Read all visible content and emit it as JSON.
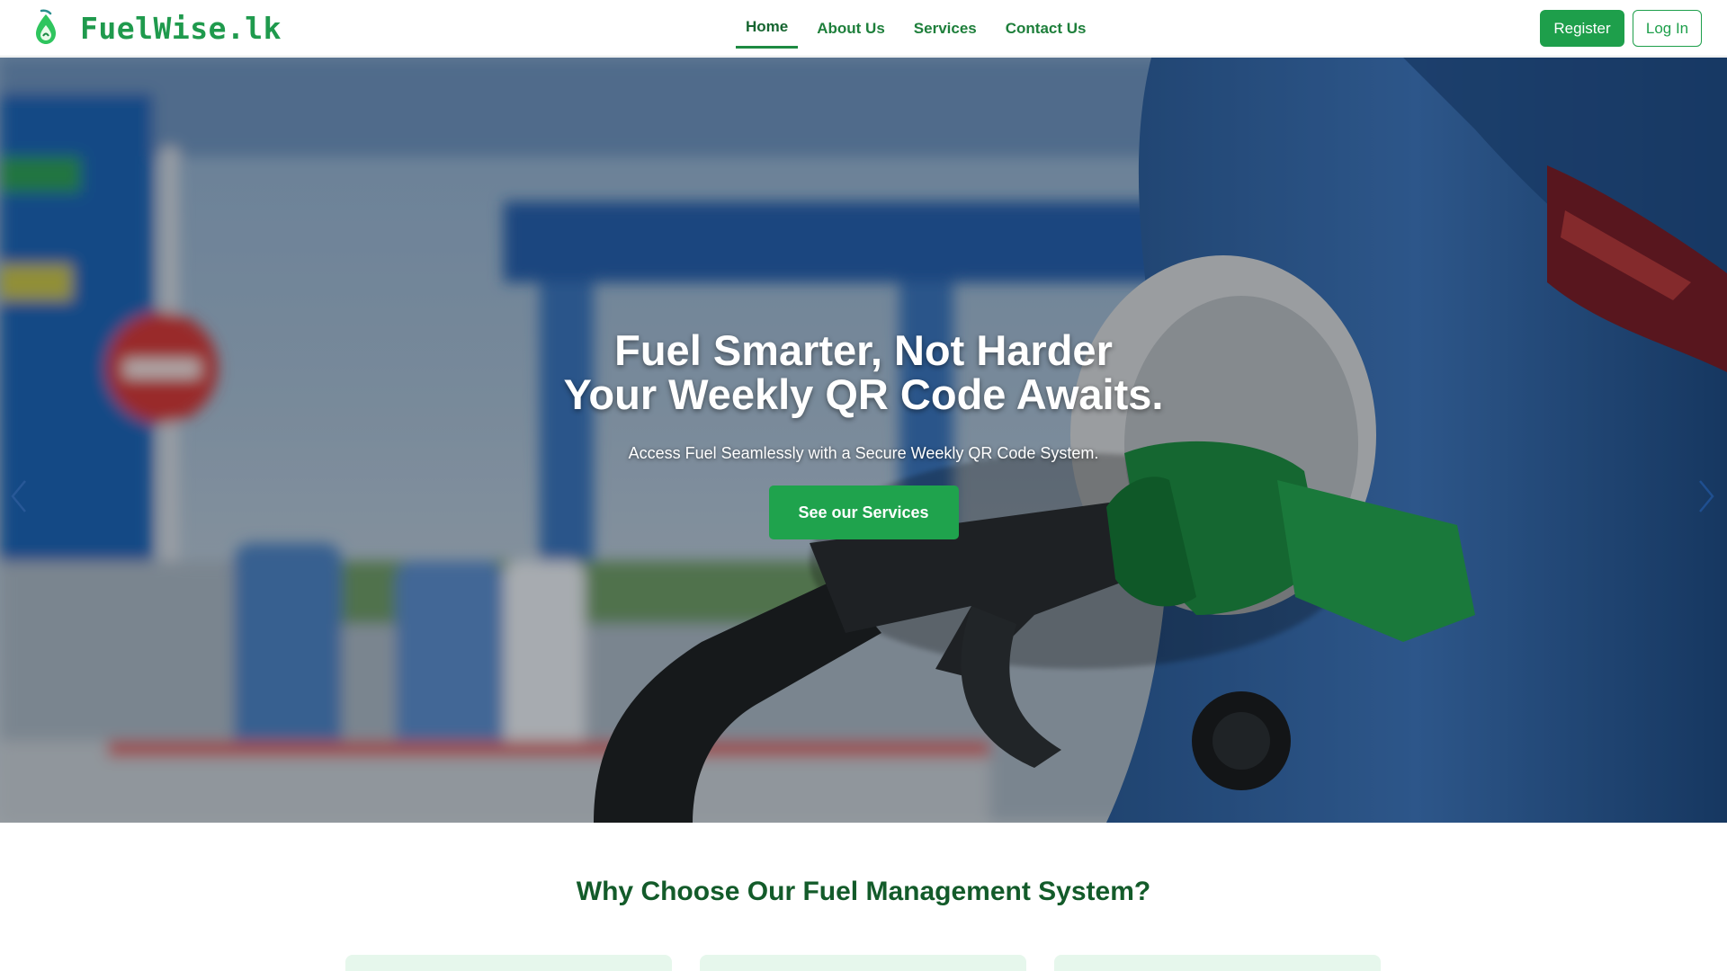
{
  "brand": {
    "name": "FuelWise.lk",
    "logo_icon": "fuel-drop-icon",
    "color": "#1f9a4d"
  },
  "nav": {
    "items": [
      {
        "label": "Home",
        "active": true
      },
      {
        "label": "About Us",
        "active": false
      },
      {
        "label": "Services",
        "active": false
      },
      {
        "label": "Contact Us",
        "active": false
      }
    ]
  },
  "auth": {
    "register_label": "Register",
    "login_label": "Log In"
  },
  "hero": {
    "title_line1": "Fuel Smarter, Not Harder",
    "title_line2": "Your Weekly QR Code Awaits.",
    "subtitle": "Access Fuel Seamlessly with a Secure Weekly QR Code System.",
    "cta_label": "See our Services",
    "prev_icon": "chevron-left-icon",
    "next_icon": "chevron-right-icon"
  },
  "why": {
    "title": "Why Choose Our Fuel Management System?"
  },
  "colors": {
    "accent": "#1e9f4b",
    "heading": "#135b2a",
    "card_bg": "#e6f7ec"
  }
}
